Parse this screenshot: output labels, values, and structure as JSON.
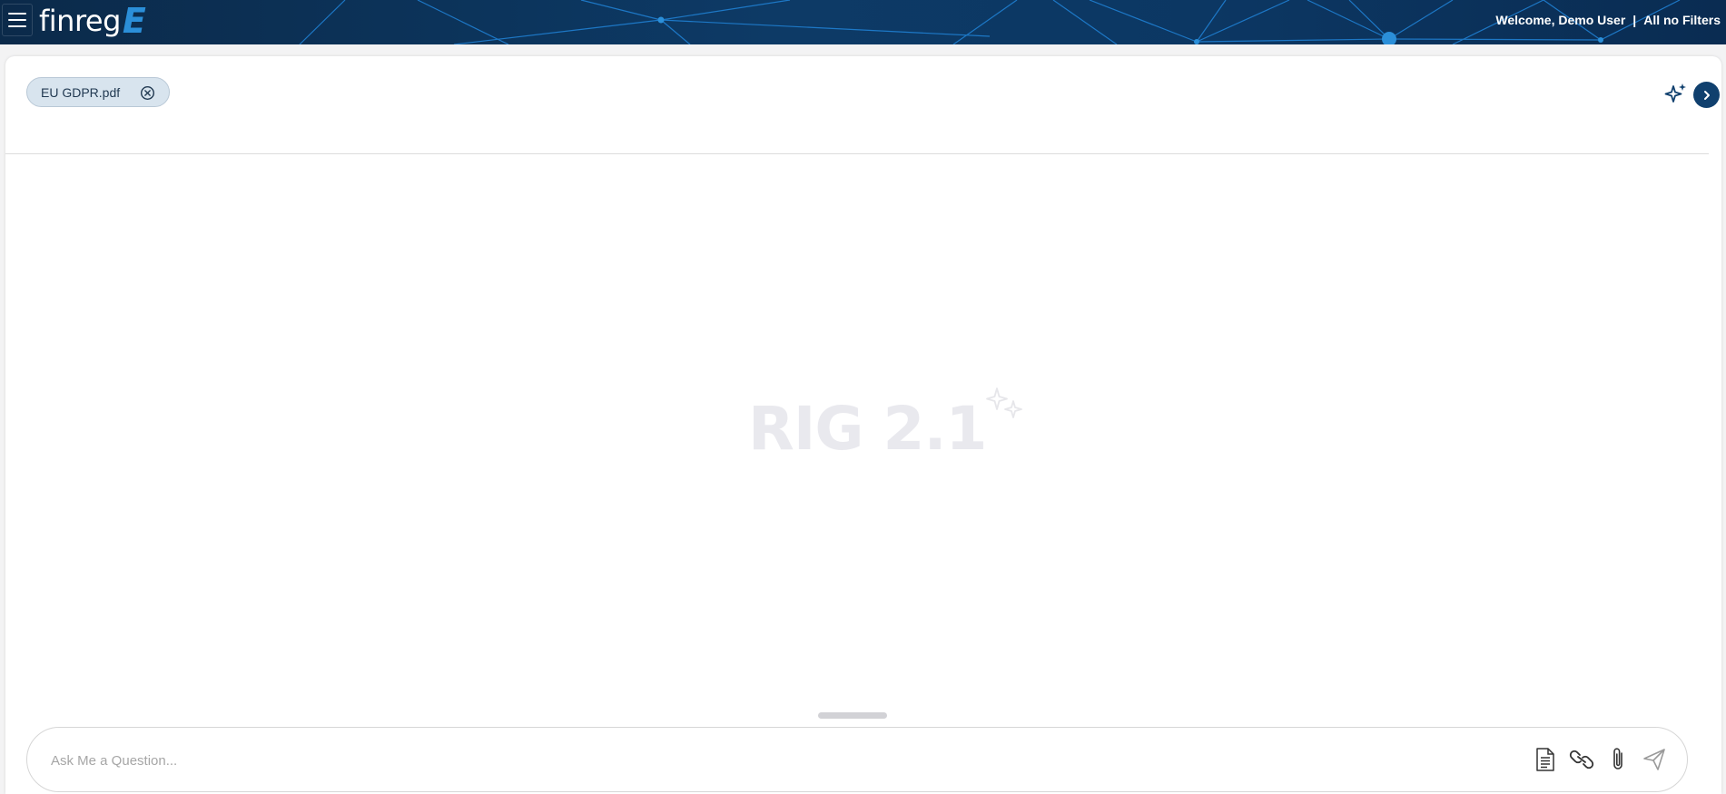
{
  "header": {
    "logo_text": "finreg",
    "logo_accent": "E",
    "welcome": "Welcome, Demo User",
    "separator": "|",
    "filter_label": "All no Filters"
  },
  "attachments": [
    {
      "name": "EU GDPR.pdf"
    }
  ],
  "brand": {
    "text": "RIG 2.1"
  },
  "chat": {
    "placeholder": "Ask Me a Question..."
  },
  "icons": {
    "menu": "hamburger-icon",
    "remove": "close-circle-icon",
    "ai": "sparkles-icon",
    "collapse": "chevron-right-icon",
    "document": "document-icon",
    "link": "link-icon",
    "attach": "paperclip-icon",
    "send": "send-icon"
  },
  "colors": {
    "header_bg": "#0c3763",
    "accent": "#2b8fd9",
    "primary_button": "#10406e",
    "chip_bg": "#d8e4ee"
  }
}
